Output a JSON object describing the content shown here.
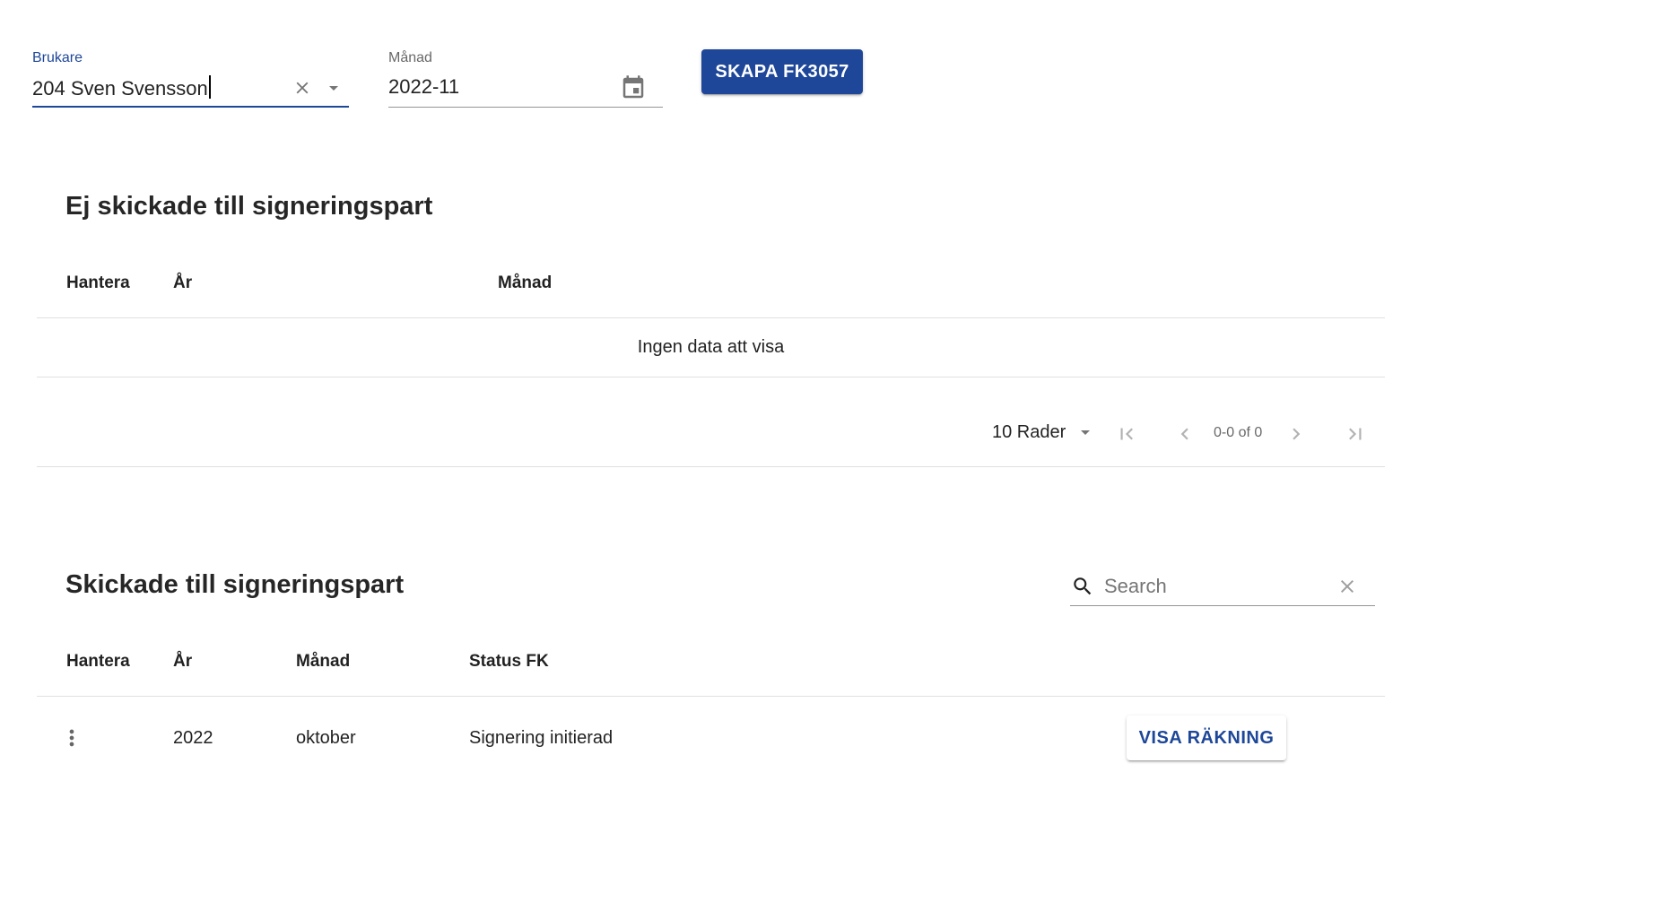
{
  "filters": {
    "brukare": {
      "label": "Brukare",
      "value": "204 Sven Svensson"
    },
    "manad": {
      "label": "Månad",
      "value": "2022-11"
    },
    "create_button": "SKAPA FK3057"
  },
  "not_sent": {
    "title": "Ej skickade till signeringspart",
    "columns": [
      "Hantera",
      "År",
      "Månad"
    ],
    "empty_message": "Ingen data att visa",
    "pagination": {
      "rows_label": "10 Rader",
      "range": "0-0 of 0"
    }
  },
  "sent": {
    "title": "Skickade till signeringspart",
    "search_placeholder": "Search",
    "columns": [
      "Hantera",
      "År",
      "Månad",
      "Status FK"
    ],
    "rows": [
      {
        "year": "2022",
        "month": "oktober",
        "status": "Signering initierad",
        "action": "VISA RÄKNING"
      }
    ]
  },
  "colors": {
    "accent": "#1e4799"
  }
}
